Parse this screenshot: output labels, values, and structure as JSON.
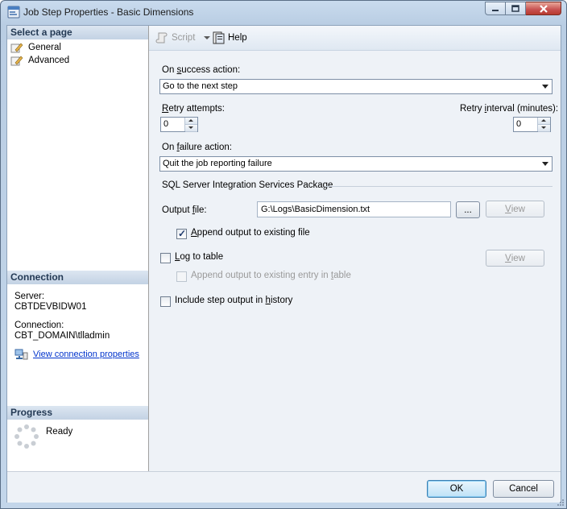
{
  "window": {
    "title": "Job Step Properties - Basic Dimensions"
  },
  "left": {
    "select_page_header": "Select a page",
    "pages": [
      {
        "label": "General"
      },
      {
        "label": "Advanced"
      }
    ],
    "connection_header": "Connection",
    "server_label": "Server:",
    "server_value": "CBTDEVBIDW01",
    "connection_label": "Connection:",
    "connection_value": "CBT_DOMAIN\\tlladmin",
    "view_conn_link": "View connection properties",
    "progress_header": "Progress",
    "progress_status": "Ready"
  },
  "toolbar": {
    "script_label": "Script",
    "help_label": "Help"
  },
  "form": {
    "on_success_label_pre": "On ",
    "on_success_label_u": "s",
    "on_success_label_post": "uccess action:",
    "on_success_value": "Go to the next step",
    "retry_attempts_label_u": "R",
    "retry_attempts_label_post": "etry attempts:",
    "retry_attempts_value": "0",
    "retry_interval_label_pre": "Retry ",
    "retry_interval_label_u": "i",
    "retry_interval_label_post": "nterval (minutes):",
    "retry_interval_value": "0",
    "on_failure_label_pre": "On ",
    "on_failure_label_u": "f",
    "on_failure_label_post": "ailure action:",
    "on_failure_value": "Quit the job reporting failure",
    "group_title": "SQL Server Integration Services Package",
    "output_file_label_pre": "Output ",
    "output_file_label_u": "f",
    "output_file_label_post": "ile:",
    "output_file_value": "G:\\Logs\\BasicDimension.txt",
    "browse_label": "...",
    "view_label_u": "V",
    "view_label_post": "iew",
    "append_output_label_u": "A",
    "append_output_label_post": "ppend output to existing file",
    "append_output_checked": true,
    "log_to_table_label_u": "L",
    "log_to_table_label_post": "og to table",
    "append_entry_label": "Append output to existing entry in ",
    "append_entry_label_u": "t",
    "append_entry_label_post": "able",
    "include_history_label": "Include step output in ",
    "include_history_label_u": "h",
    "include_history_label_post": "istory"
  },
  "footer": {
    "ok_label": "OK",
    "cancel_label": "Cancel"
  }
}
